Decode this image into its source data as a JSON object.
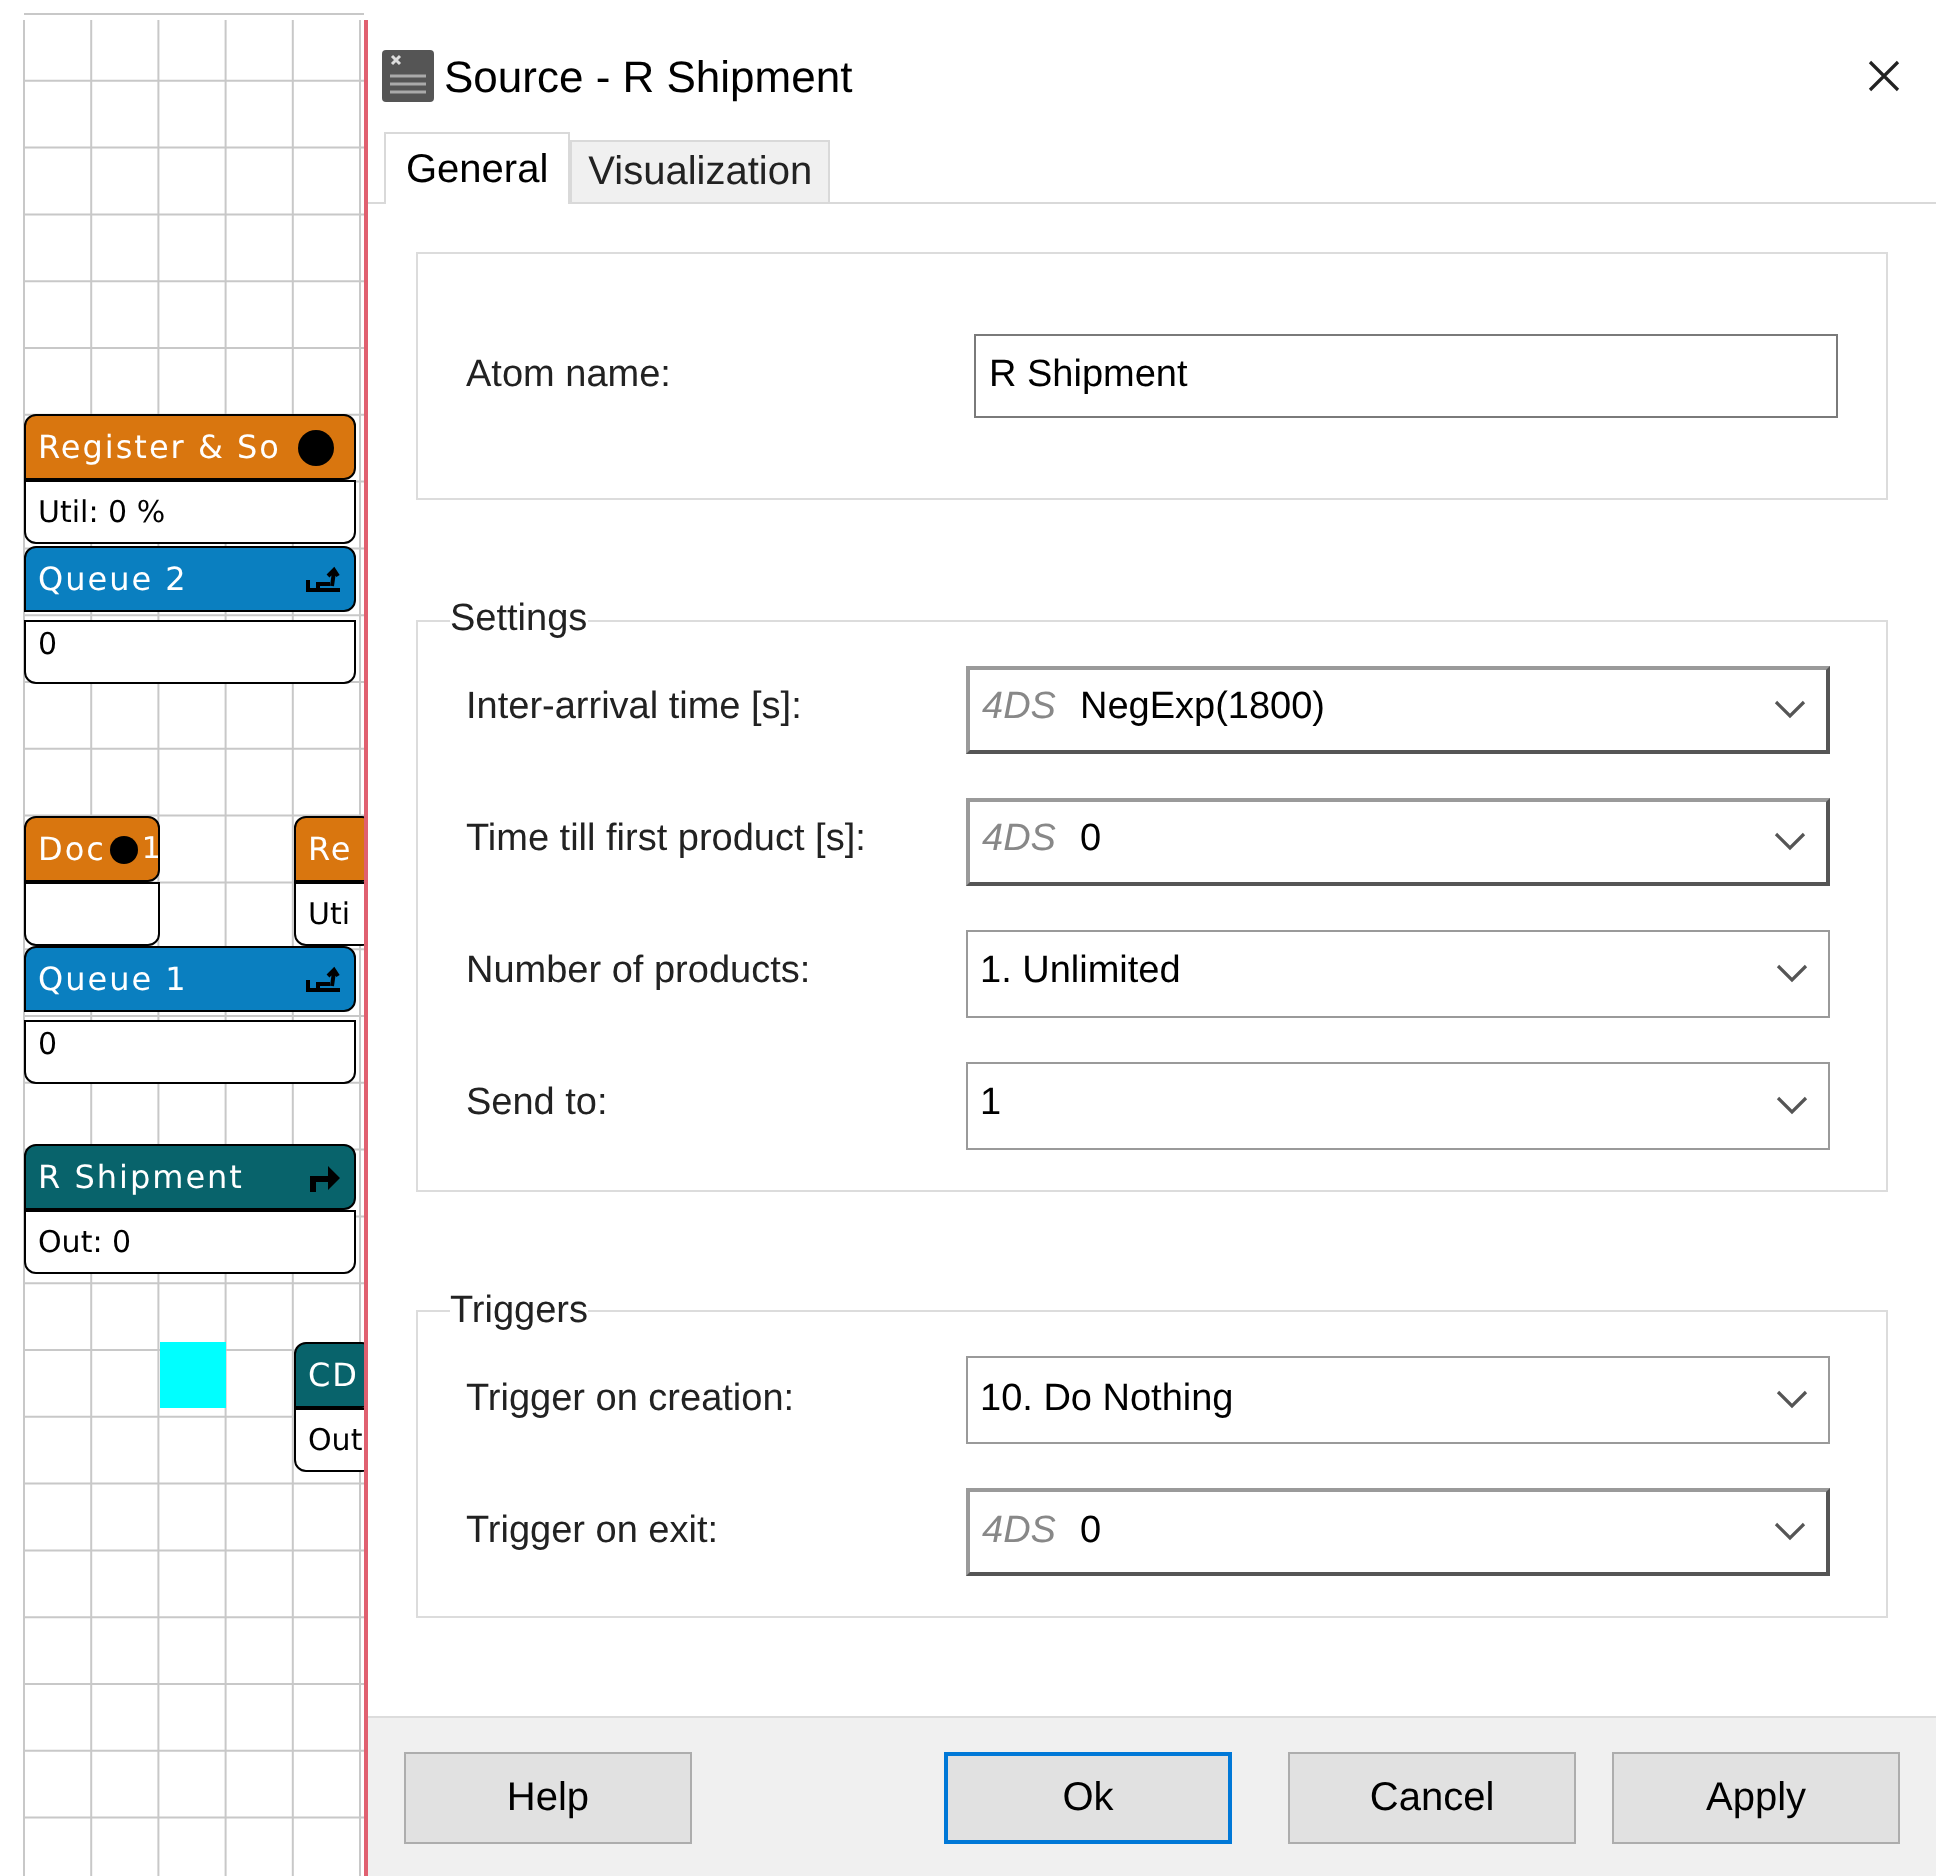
{
  "canvas": {
    "nodes": [
      {
        "kind": "process",
        "title": "Register & So",
        "body": "Util: 0 %"
      },
      {
        "kind": "queue",
        "title": "Queue 2",
        "body": "0"
      },
      {
        "kind": "process",
        "title": "Doc",
        "title_end": "1"
      },
      {
        "kind": "process",
        "title": "Re",
        "body": "Uti"
      },
      {
        "kind": "queue",
        "title": "Queue 1",
        "body": "0"
      },
      {
        "kind": "source",
        "title": "R Shipment",
        "body": "Out: 0"
      },
      {
        "kind": "marker"
      },
      {
        "kind": "sink",
        "title": "CD",
        "body": "Out"
      }
    ]
  },
  "dialog": {
    "title": "Source - R Shipment",
    "tabs": [
      {
        "label": "General",
        "selected": true
      },
      {
        "label": "Visualization",
        "selected": false
      }
    ],
    "atom_name": {
      "label": "Atom name:",
      "value": "R Shipment"
    },
    "groups": [
      {
        "title": "Settings",
        "fields": [
          {
            "kind": "expression",
            "label": "Inter-arrival time [s]:",
            "prefix": "4DS",
            "value": "NegExp(1800)"
          },
          {
            "kind": "expression",
            "label": "Time till first product [s]:",
            "prefix": "4DS",
            "value": "0"
          },
          {
            "kind": "select",
            "label": "Number of products:",
            "value": "1. Unlimited"
          },
          {
            "kind": "select",
            "label": "Send to:",
            "value": "1"
          }
        ]
      },
      {
        "title": "Triggers",
        "fields": [
          {
            "kind": "select",
            "label": "Trigger on creation:",
            "value": "10. Do Nothing"
          },
          {
            "kind": "expression",
            "label": "Trigger on exit:",
            "prefix": "4DS",
            "value": "0"
          }
        ]
      }
    ],
    "buttons": [
      {
        "label": "Help",
        "default": false
      },
      {
        "label": "Ok",
        "default": true
      },
      {
        "label": "Cancel",
        "default": false
      },
      {
        "label": "Apply",
        "default": false
      }
    ]
  }
}
